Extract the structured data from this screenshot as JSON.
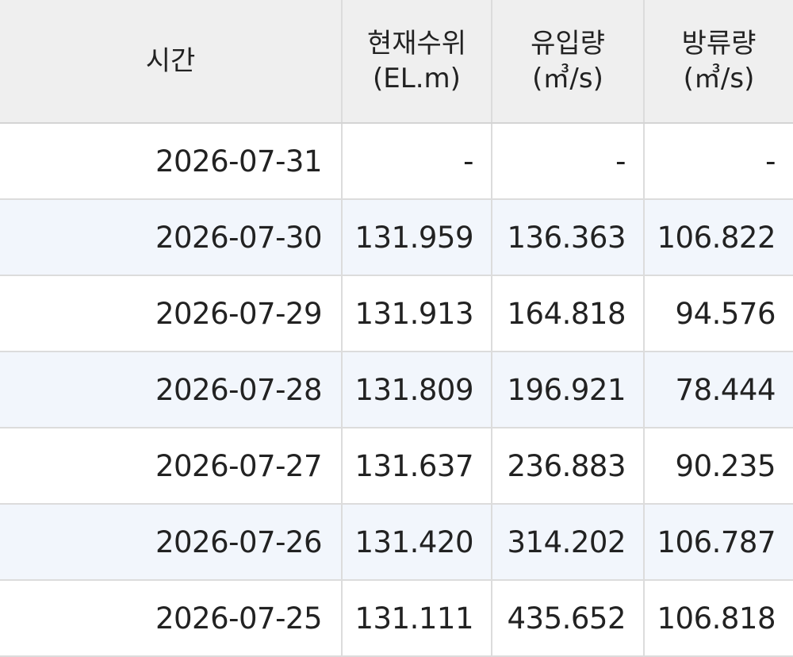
{
  "headers": {
    "time": "시간",
    "level_line1": "현재수위",
    "level_line2": "(EL.m)",
    "inflow_line1": "유입량",
    "inflow_line2": "(㎥/s)",
    "outflow_line1": "방류량",
    "outflow_line2": "(㎥/s)"
  },
  "rows": [
    {
      "time": "2026-07-31",
      "level": "-",
      "inflow": "-",
      "outflow": "-"
    },
    {
      "time": "2026-07-30",
      "level": "131.959",
      "inflow": "136.363",
      "outflow": "106.822"
    },
    {
      "time": "2026-07-29",
      "level": "131.913",
      "inflow": "164.818",
      "outflow": "94.576"
    },
    {
      "time": "2026-07-28",
      "level": "131.809",
      "inflow": "196.921",
      "outflow": "78.444"
    },
    {
      "time": "2026-07-27",
      "level": "131.637",
      "inflow": "236.883",
      "outflow": "90.235"
    },
    {
      "time": "2026-07-26",
      "level": "131.420",
      "inflow": "314.202",
      "outflow": "106.787"
    },
    {
      "time": "2026-07-25",
      "level": "131.111",
      "inflow": "435.652",
      "outflow": "106.818"
    }
  ]
}
